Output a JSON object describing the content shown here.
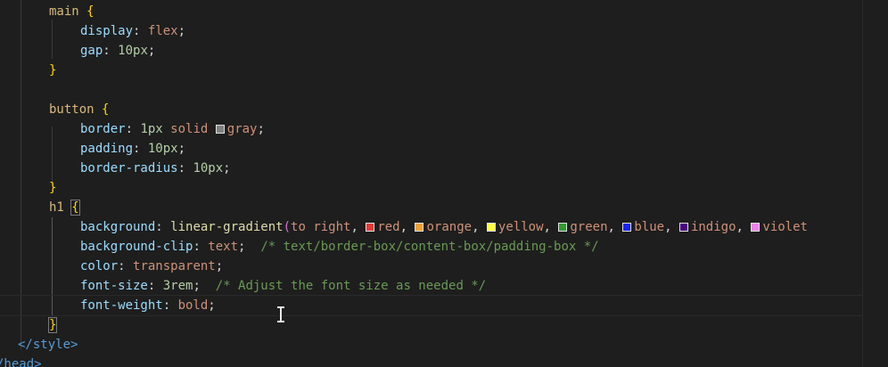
{
  "editor": {
    "main_selector": "main",
    "main_props": [
      {
        "prop": "display",
        "value": "flex"
      },
      {
        "prop": "gap",
        "value": "10px"
      }
    ],
    "button_selector": "button",
    "button_border_prop": "border",
    "button_border_width": "1px",
    "button_border_style": "solid",
    "button_border_color": "gray",
    "button_border_swatch": "#808080",
    "button_padding_prop": "padding",
    "button_padding_value": "10px",
    "button_radius_prop": "border-radius",
    "button_radius_value": "10px",
    "h1_selector": "h1",
    "bg_prop": "background",
    "gradient_fn": "linear-gradient",
    "gradient_dir": "to right",
    "gradient_colors": [
      {
        "name": "red",
        "swatch": "#e53935"
      },
      {
        "name": "orange",
        "swatch": "#f0a030"
      },
      {
        "name": "yellow",
        "swatch": "#ffff40"
      },
      {
        "name": "green",
        "swatch": "#2e9e2e"
      },
      {
        "name": "blue",
        "swatch": "#1a22ff"
      },
      {
        "name": "indigo",
        "swatch": "#4b0082"
      },
      {
        "name": "violet",
        "swatch": "#ee82ee"
      }
    ],
    "clip_prop": "background-clip",
    "clip_value": "text",
    "clip_comment": "/* text/border-box/content-box/padding-box */",
    "color_prop": "color",
    "color_value": "transparent",
    "fontsize_prop": "font-size",
    "fontsize_value": "3rem",
    "fontsize_comment": "/* Adjust the font size as needed */",
    "fontweight_prop": "font-weight",
    "fontweight_value": "bold",
    "close_style_tag": "</style>",
    "close_head_tag": "/head>"
  }
}
